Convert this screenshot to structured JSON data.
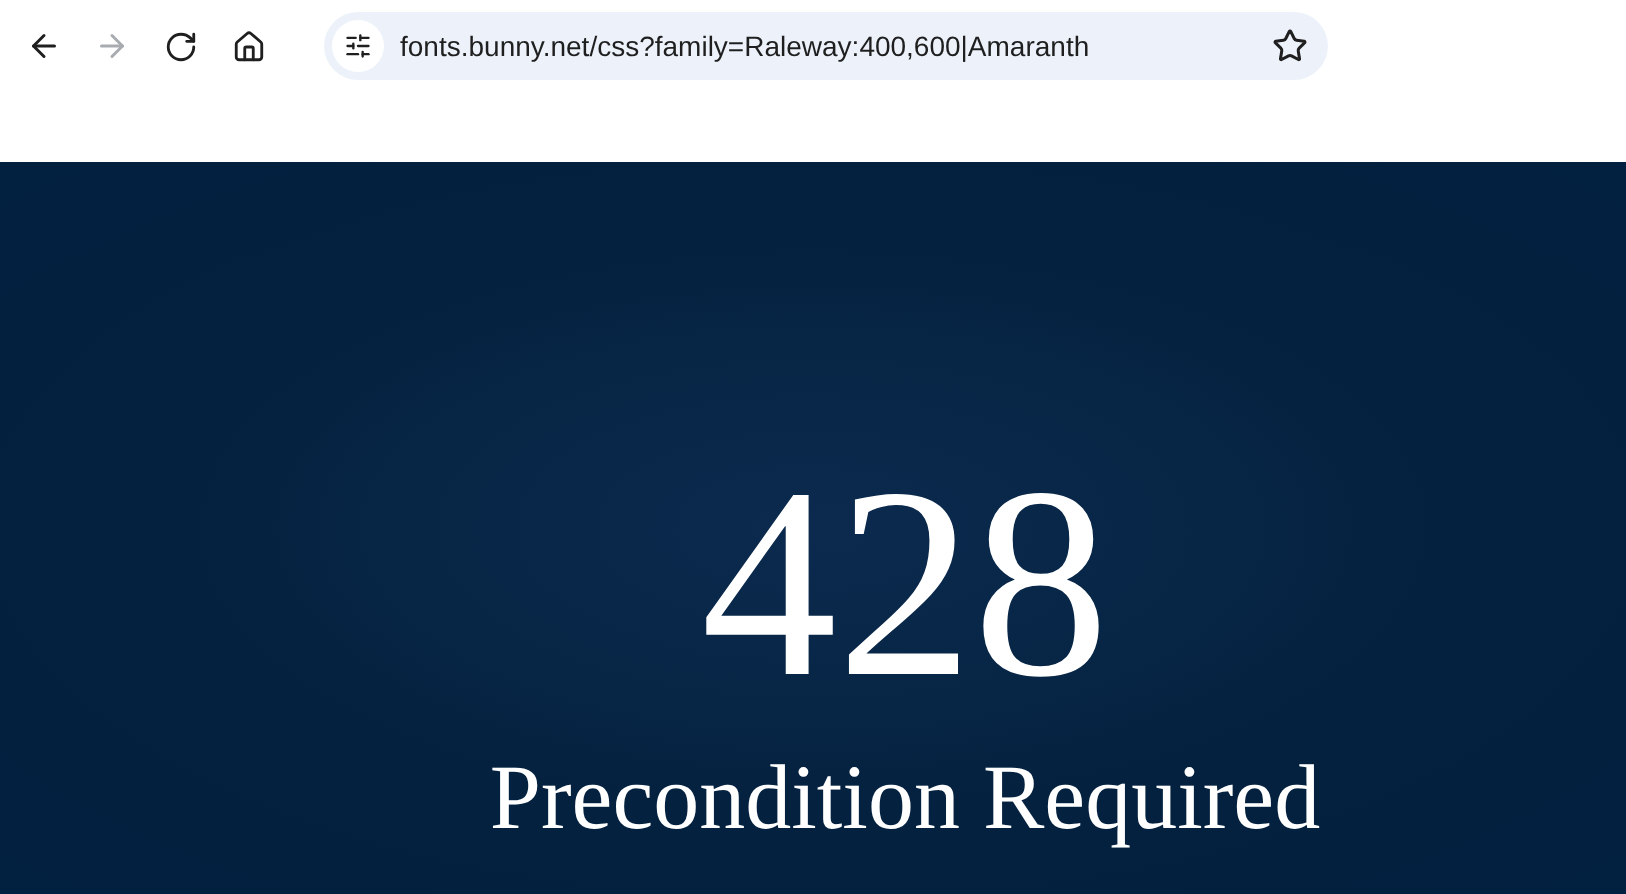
{
  "toolbar": {
    "back": {
      "disabled": false
    },
    "forward": {
      "disabled": true
    },
    "address": "fonts.bunny.net/css?family=Raleway:400,600|Amaranth"
  },
  "error": {
    "code": "428",
    "message": "Precondition Required"
  }
}
